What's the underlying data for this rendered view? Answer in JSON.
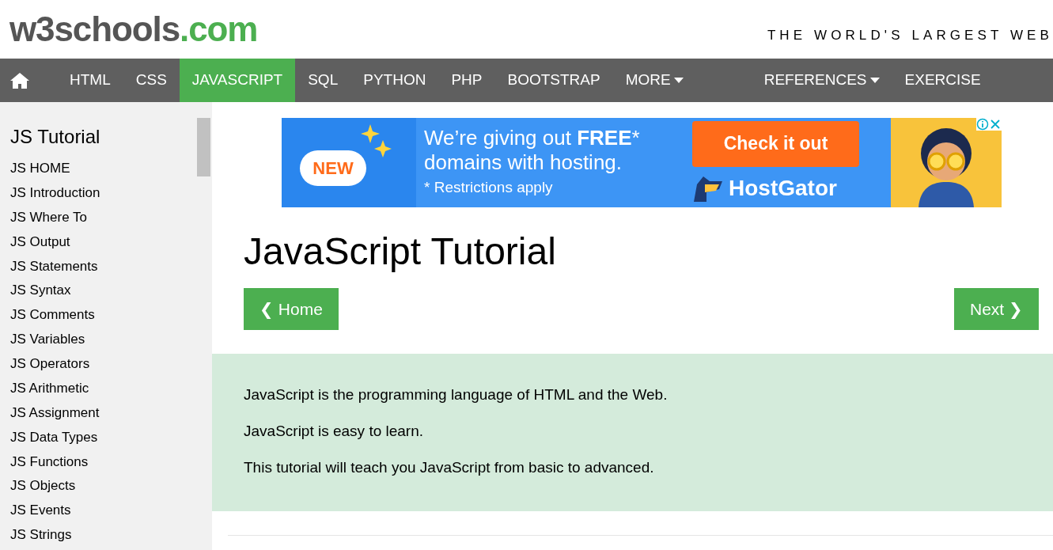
{
  "logo": {
    "main": "w3schools",
    "suffix": ".com"
  },
  "tagline": "THE WORLD'S LARGEST WEB",
  "nav": {
    "left": [
      {
        "label": "HTML",
        "selected": false,
        "dropdown": false
      },
      {
        "label": "CSS",
        "selected": false,
        "dropdown": false
      },
      {
        "label": "JAVASCRIPT",
        "selected": true,
        "dropdown": false
      },
      {
        "label": "SQL",
        "selected": false,
        "dropdown": false
      },
      {
        "label": "PYTHON",
        "selected": false,
        "dropdown": false
      },
      {
        "label": "PHP",
        "selected": false,
        "dropdown": false
      },
      {
        "label": "BOOTSTRAP",
        "selected": false,
        "dropdown": false
      },
      {
        "label": "MORE",
        "selected": false,
        "dropdown": true
      }
    ],
    "right": [
      {
        "label": "REFERENCES",
        "selected": false,
        "dropdown": true
      },
      {
        "label": "EXERCISE",
        "selected": false,
        "dropdown": false
      }
    ]
  },
  "sidebar": {
    "title": "JS Tutorial",
    "items": [
      "JS HOME",
      "JS Introduction",
      "JS Where To",
      "JS Output",
      "JS Statements",
      "JS Syntax",
      "JS Comments",
      "JS Variables",
      "JS Operators",
      "JS Arithmetic",
      "JS Assignment",
      "JS Data Types",
      "JS Functions",
      "JS Objects",
      "JS Events",
      "JS Strings"
    ]
  },
  "ad": {
    "badge": "NEW",
    "headline": "We’re giving out **FREE***",
    "headline_2": "domains with hosting.",
    "note": "* Restrictions apply",
    "cta": "Check it out",
    "brand": "HostGator"
  },
  "main": {
    "title": "JavaScript Tutorial",
    "prev": "❮ Home",
    "next": "Next ❯",
    "intro": [
      "JavaScript is the programming language of HTML and the Web.",
      "JavaScript is easy to learn.",
      "This tutorial will teach you JavaScript from basic to advanced."
    ]
  }
}
